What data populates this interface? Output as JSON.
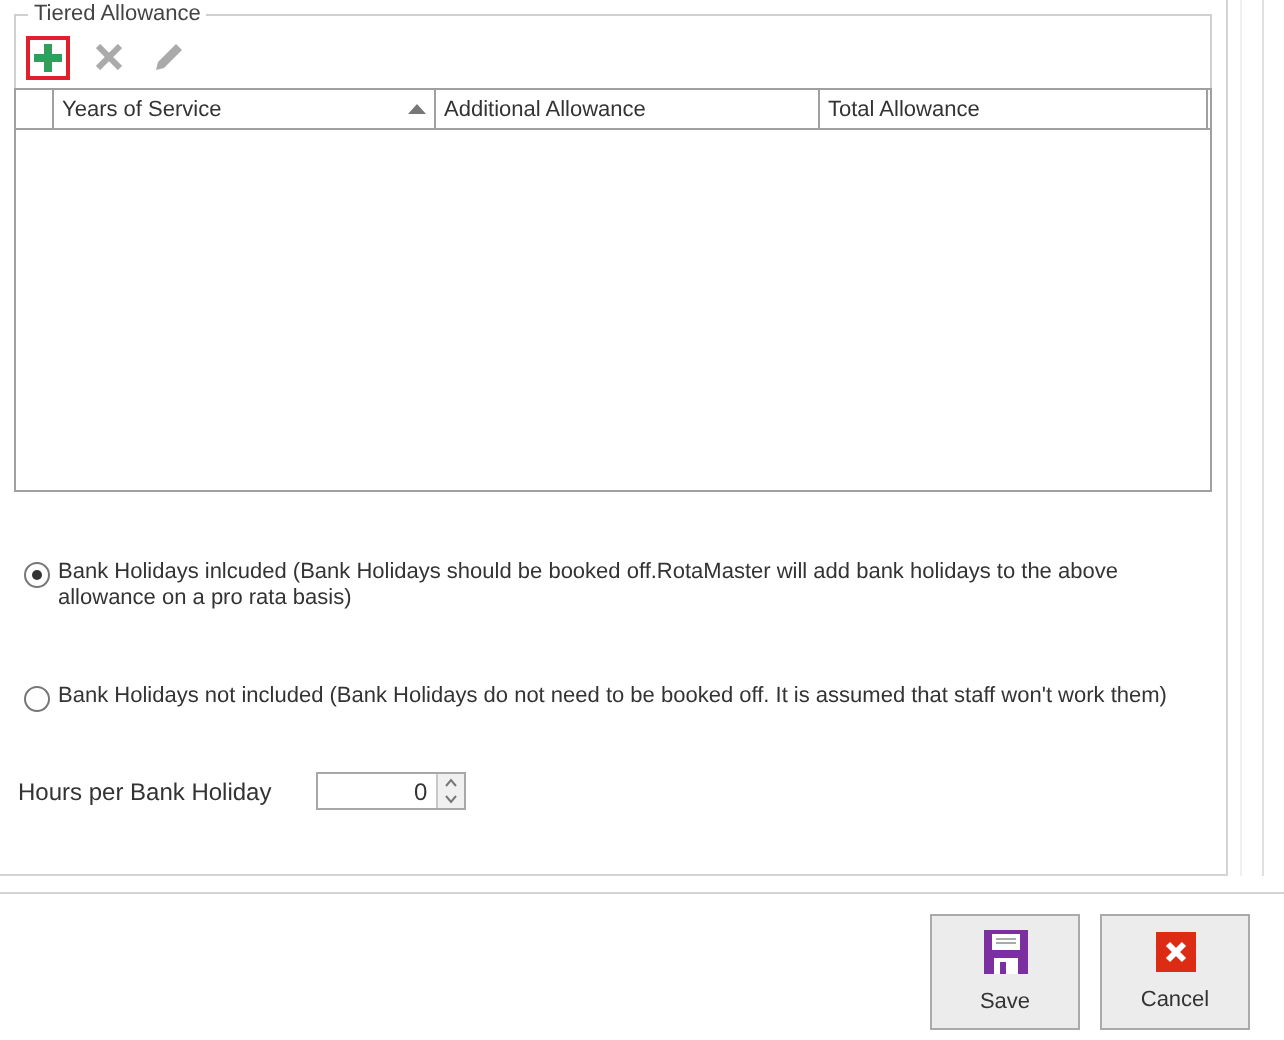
{
  "tiered_allowance": {
    "title": "Tiered Allowance",
    "toolbar": [
      {
        "kind": "add",
        "disabled": false,
        "selected": true
      },
      {
        "kind": "delete",
        "disabled": true,
        "selected": false
      },
      {
        "kind": "edit",
        "disabled": true,
        "selected": false
      }
    ],
    "table": {
      "columns": [
        {
          "label": "Years of Service",
          "sorted": true
        },
        {
          "label": "Additional Allowance",
          "sorted": false
        },
        {
          "label": "Total Allowance",
          "sorted": false
        }
      ]
    }
  },
  "bank_holiday_options": [
    {
      "label": "Bank Holidays inlcuded (Bank Holidays should be booked off.RotaMaster will add bank holidays to the above allowance on a pro rata basis)",
      "selected": true
    },
    {
      "label": "Bank Holidays not included (Bank Holidays do not need to be booked off. It is assumed that staff won't work them)",
      "selected": false
    }
  ],
  "hours_per_bank_holiday": {
    "label": "Hours per Bank Holiday",
    "value": "0"
  },
  "buttons": [
    {
      "kind": "save",
      "label": "Save"
    },
    {
      "kind": "cancel",
      "label": "Cancel"
    }
  ]
}
